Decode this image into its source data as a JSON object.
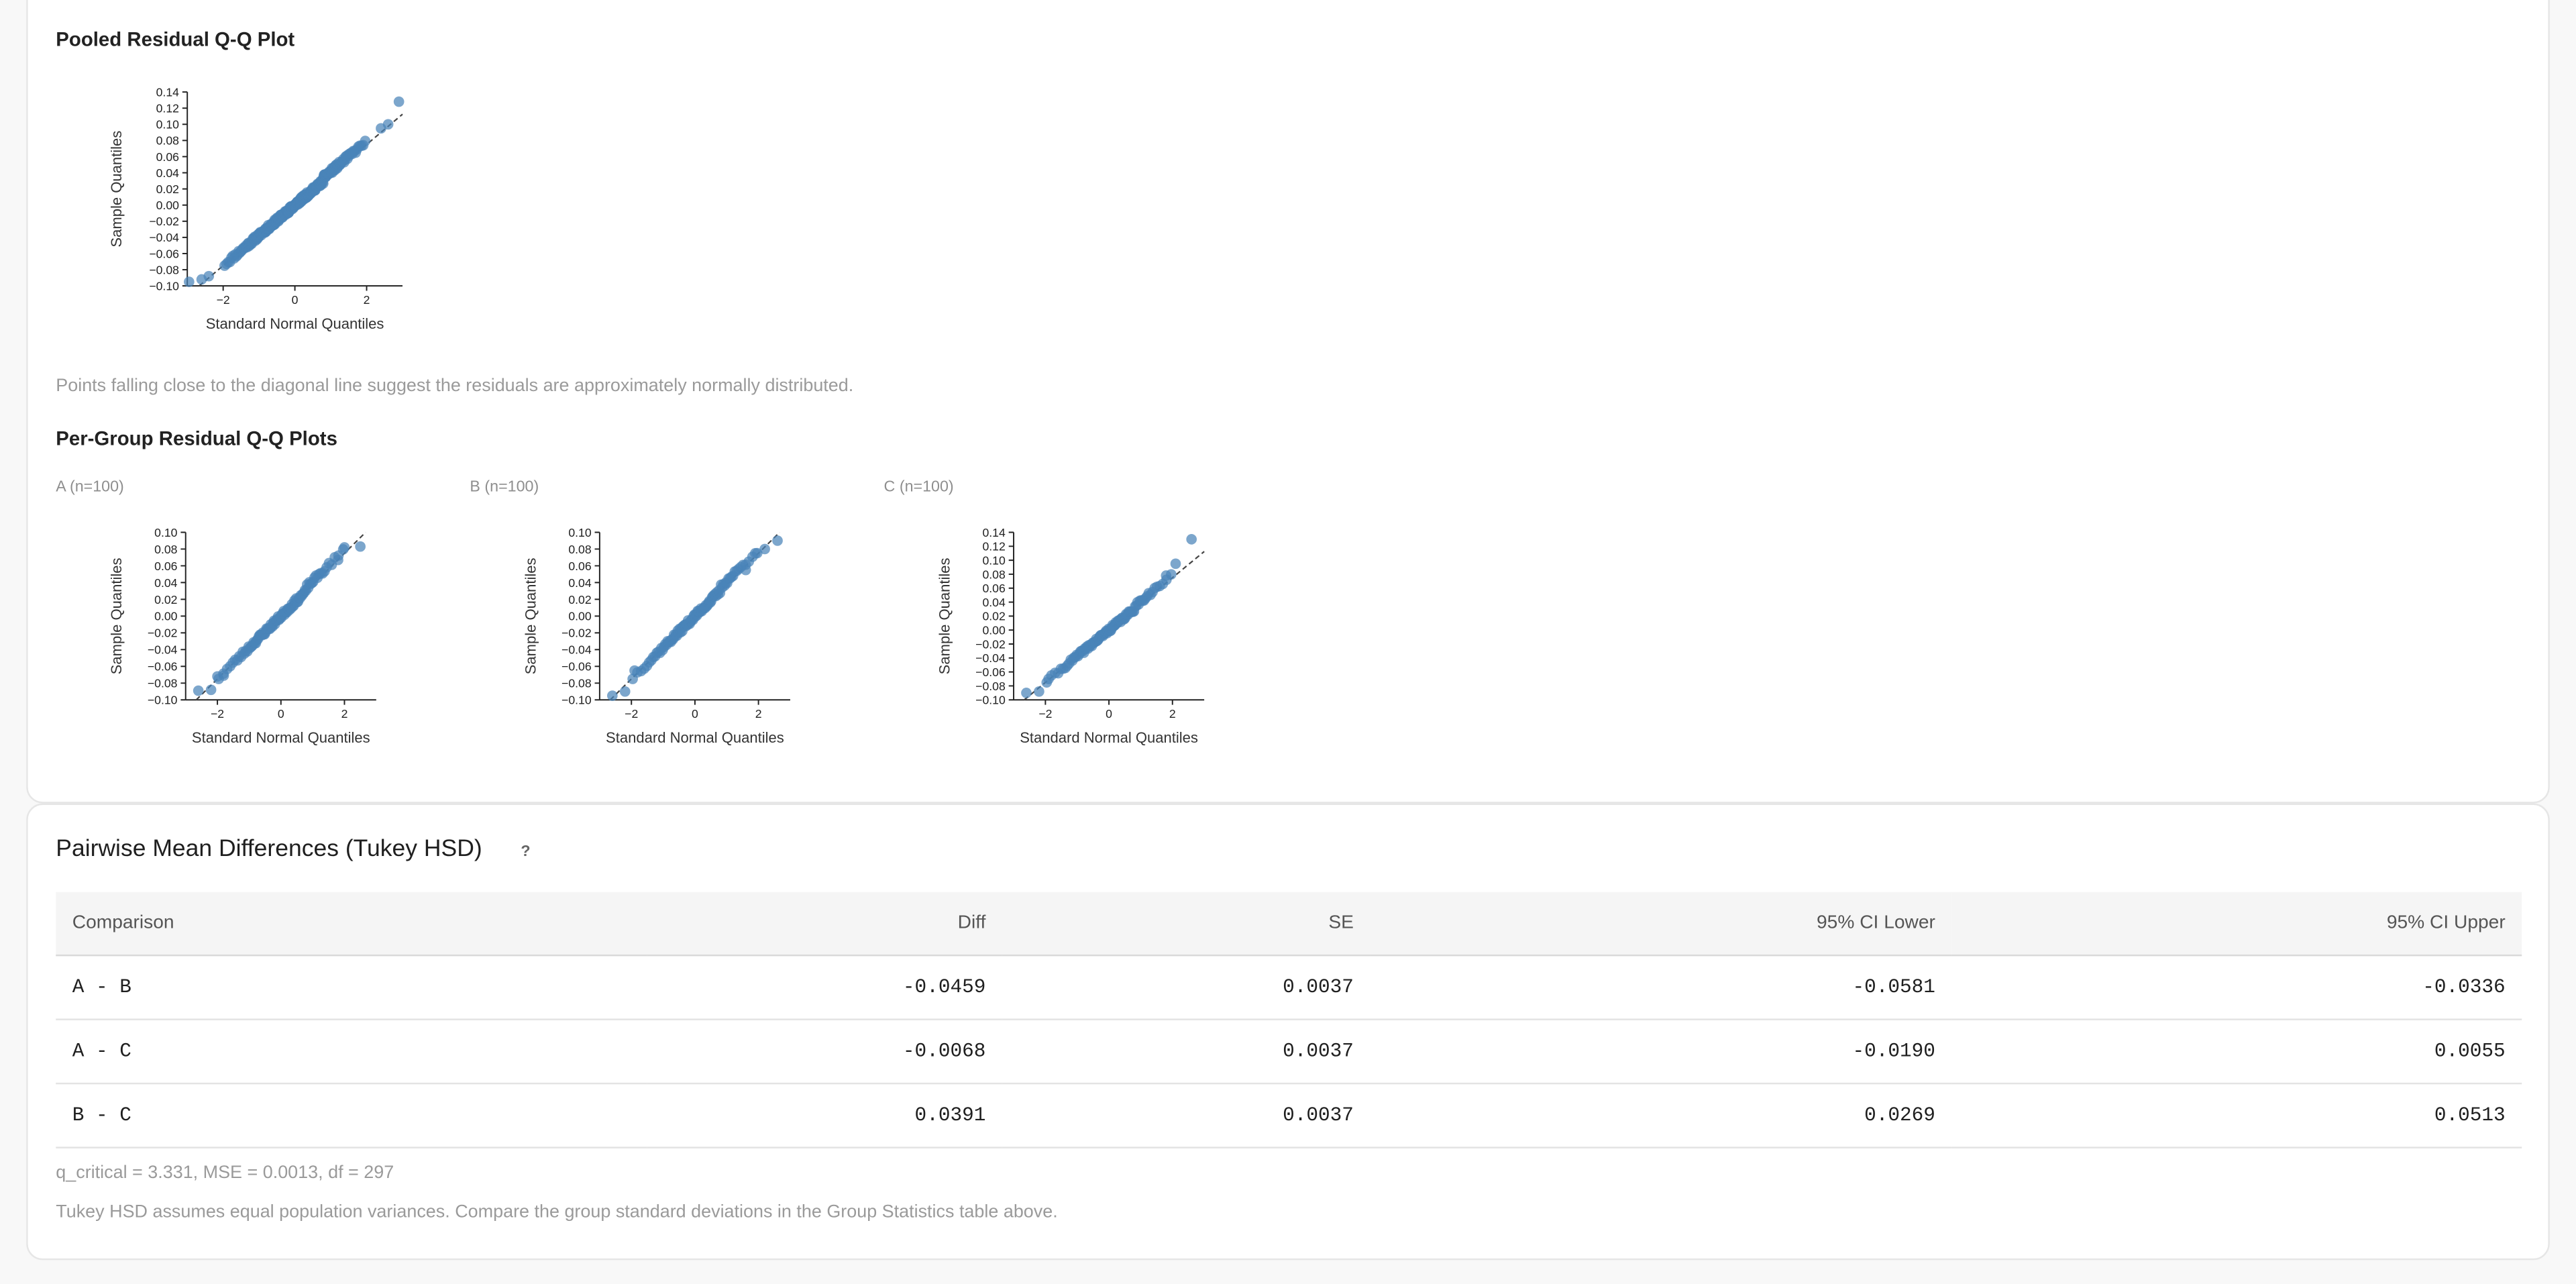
{
  "pooled": {
    "title": "Pooled Residual Q-Q Plot",
    "note": "Points falling close to the diagonal line suggest the residuals are approximately normally distributed."
  },
  "per_group": {
    "title": "Per-Group Residual Q-Q Plots",
    "groups": [
      "A (n=100)",
      "B (n=100)",
      "C (n=100)"
    ]
  },
  "chart_data": [
    {
      "id": "pooled",
      "type": "scatter",
      "xlabel": "Standard Normal Quantiles",
      "ylabel": "Sample Quantiles",
      "x_ticks": [
        -2,
        0,
        2
      ],
      "y_ticks": [
        -0.1,
        -0.08,
        -0.06,
        -0.04,
        -0.02,
        0.0,
        0.02,
        0.04,
        0.06,
        0.08,
        0.1,
        0.12,
        0.14
      ],
      "xlim": [
        -3.0,
        3.0
      ],
      "ylim": [
        -0.1,
        0.14
      ],
      "n": 300,
      "slope": 0.0375,
      "intercept": 0.0,
      "points": [
        [
          -2.95,
          -0.095
        ],
        [
          -2.6,
          -0.092
        ],
        [
          -2.4,
          -0.088
        ],
        [
          2.4,
          0.095
        ],
        [
          2.6,
          0.1
        ],
        [
          2.9,
          0.128
        ]
      ]
    },
    {
      "id": "A",
      "type": "scatter",
      "xlabel": "Standard Normal Quantiles",
      "ylabel": "Sample Quantiles",
      "x_ticks": [
        -2,
        0,
        2
      ],
      "y_ticks": [
        -0.1,
        -0.08,
        -0.06,
        -0.04,
        -0.02,
        0.0,
        0.02,
        0.04,
        0.06,
        0.08,
        0.1
      ],
      "xlim": [
        -3.0,
        3.0
      ],
      "ylim": [
        -0.1,
        0.1
      ],
      "n": 100,
      "slope": 0.0375,
      "intercept": 0.0,
      "points": [
        [
          -2.6,
          -0.089
        ],
        [
          -2.2,
          -0.088
        ],
        [
          -2.0,
          -0.072
        ],
        [
          -1.8,
          -0.071
        ],
        [
          1.8,
          0.067
        ],
        [
          2.0,
          0.082
        ],
        [
          2.5,
          0.083
        ]
      ]
    },
    {
      "id": "B",
      "type": "scatter",
      "xlabel": "Standard Normal Quantiles",
      "ylabel": "Sample Quantiles",
      "x_ticks": [
        -2,
        0,
        2
      ],
      "y_ticks": [
        -0.1,
        -0.08,
        -0.06,
        -0.04,
        -0.02,
        0.0,
        0.02,
        0.04,
        0.06,
        0.08,
        0.1
      ],
      "xlim": [
        -3.0,
        3.0
      ],
      "ylim": [
        -0.1,
        0.1
      ],
      "n": 100,
      "slope": 0.0375,
      "intercept": 0.0,
      "points": [
        [
          -2.6,
          -0.095
        ],
        [
          -2.2,
          -0.09
        ],
        [
          -1.9,
          -0.065
        ],
        [
          1.6,
          0.055
        ],
        [
          1.9,
          0.075
        ],
        [
          2.2,
          0.08
        ],
        [
          2.6,
          0.09
        ]
      ]
    },
    {
      "id": "C",
      "type": "scatter",
      "xlabel": "Standard Normal Quantiles",
      "ylabel": "Sample Quantiles",
      "x_ticks": [
        -2,
        0,
        2
      ],
      "y_ticks": [
        -0.1,
        -0.08,
        -0.06,
        -0.04,
        -0.02,
        0.0,
        0.02,
        0.04,
        0.06,
        0.08,
        0.1,
        0.12,
        0.14
      ],
      "xlim": [
        -3.0,
        3.0
      ],
      "ylim": [
        -0.1,
        0.14
      ],
      "n": 100,
      "slope": 0.0375,
      "intercept": 0.0,
      "points": [
        [
          -2.6,
          -0.09
        ],
        [
          -2.2,
          -0.088
        ],
        [
          -1.9,
          -0.07
        ],
        [
          1.8,
          0.078
        ],
        [
          2.1,
          0.095
        ],
        [
          2.6,
          0.13
        ]
      ]
    }
  ],
  "tukey": {
    "title": "Pairwise Mean Differences (Tukey HSD)",
    "help": "?",
    "headers": [
      "Comparison",
      "Diff",
      "SE",
      "95% CI Lower",
      "95% CI Upper"
    ],
    "rows": [
      [
        "A - B",
        "-0.0459",
        "0.0037",
        "-0.0581",
        "-0.0336"
      ],
      [
        "A - C",
        "-0.0068",
        "0.0037",
        "-0.0190",
        "0.0055"
      ],
      [
        "B - C",
        "0.0391",
        "0.0037",
        "0.0269",
        "0.0513"
      ]
    ],
    "params": "q_critical = 3.331, MSE = 0.0013, df = 297",
    "note": "Tukey HSD assumes equal population variances. Compare the group standard deviations in the Group Statistics table above."
  },
  "colors": {
    "point": "#4a84b8",
    "line": "#444444"
  }
}
